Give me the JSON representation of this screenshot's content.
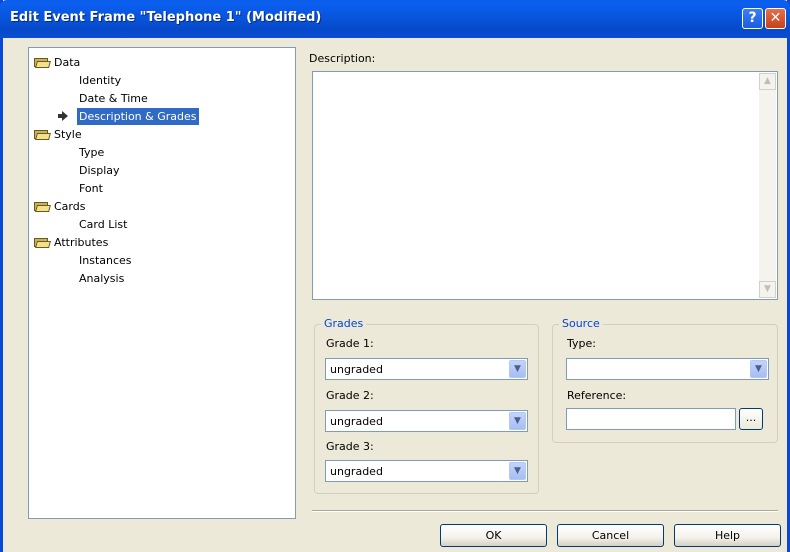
{
  "window": {
    "title": "Edit Event Frame \"Telephone 1\" (Modified)"
  },
  "titlebar": {
    "help_glyph": "?",
    "close_glyph": "✕"
  },
  "tree": {
    "groups": [
      {
        "label": "Data",
        "children": [
          "Identity",
          "Date & Time",
          "Description & Grades"
        ]
      },
      {
        "label": "Style",
        "children": [
          "Type",
          "Display",
          "Font"
        ]
      },
      {
        "label": "Cards",
        "children": [
          "Card List"
        ]
      },
      {
        "label": "Attributes",
        "children": [
          "Instances",
          "Analysis"
        ]
      }
    ],
    "selected": "Description & Grades"
  },
  "description": {
    "label": "Description:",
    "value": ""
  },
  "grades": {
    "title": "Grades",
    "grade1_label": "Grade 1:",
    "grade1_value": "ungraded",
    "grade2_label": "Grade 2:",
    "grade2_value": "ungraded",
    "grade3_label": "Grade 3:",
    "grade3_value": "ungraded"
  },
  "source": {
    "title": "Source",
    "type_label": "Type:",
    "type_value": "",
    "reference_label": "Reference:",
    "reference_value": "",
    "browse_label": "..."
  },
  "buttons": {
    "ok": "OK",
    "cancel": "Cancel",
    "help": "Help"
  },
  "icons": {
    "folder": "folder-icon",
    "arrow": "arrow-right-icon",
    "dropdown": "chevron-down-icon",
    "scroll_up": "scroll-up-icon",
    "scroll_down": "scroll-down-icon"
  },
  "colors": {
    "titlebar": "#0a58e0",
    "selection": "#316ac5",
    "groupbox_title": "#0046d5",
    "dialog_bg": "#ece9d8"
  }
}
